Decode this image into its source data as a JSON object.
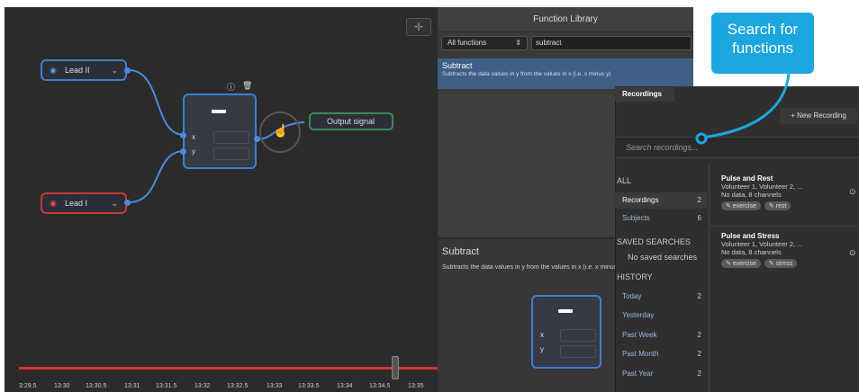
{
  "canvas": {
    "corner_icon": "crosshair-icon",
    "input_nodes": [
      {
        "label": "Lead II",
        "color": "#3f7fd1"
      },
      {
        "label": "Lead I",
        "color": "#c8393a"
      }
    ],
    "function_node": {
      "port_x": "x",
      "port_y": "y"
    },
    "output_node": {
      "label": "Output signal",
      "color": "#3a8a57"
    },
    "timeline": {
      "ticks": [
        "3:29.5",
        "13:30",
        "13:30.5",
        "13:31",
        "13:31.5",
        "13:32",
        "13:32.5",
        "13:33",
        "13:33.5",
        "13:34",
        "13:34.5",
        "13:35"
      ]
    }
  },
  "library": {
    "title": "Function Library",
    "filter_value": "All functions",
    "search_value": "subtract",
    "result": {
      "title": "Subtract",
      "description": "Subtracts the data values in y from the values in x (i.e. x minus y)"
    },
    "detail": {
      "title": "Subtract",
      "description": "Subtracts the data values in y from the values in x (i.e. x minus y)",
      "port_x": "x",
      "port_y": "y"
    }
  },
  "recordings": {
    "tab": "Recordings",
    "new_button": "+ New Recording",
    "search_placeholder": "Search recordings...",
    "all_heading": "ALL",
    "all_items": [
      {
        "label": "Recordings",
        "count": "2"
      },
      {
        "label": "Subjects",
        "count": "6"
      }
    ],
    "saved_heading": "SAVED SEARCHES",
    "saved_empty": "No saved searches",
    "history_heading": "HISTORY",
    "history_items": [
      {
        "label": "Today",
        "count": "2"
      },
      {
        "label": "Yesterday",
        "count": ""
      },
      {
        "label": "Past Week",
        "count": "2"
      },
      {
        "label": "Past Month",
        "count": "2"
      },
      {
        "label": "Past Year",
        "count": "2"
      }
    ],
    "items": [
      {
        "title": "Pulse and Rest",
        "subjects": "Volunteer 1, Volunteer 2, ...",
        "info": "No data, 8 channels",
        "tags": [
          "exercise",
          "rest"
        ]
      },
      {
        "title": "Pulse and Stress",
        "subjects": "Volunteer 1, Volunteer 2, ...",
        "info": "No data, 8 channels",
        "tags": [
          "exercise",
          "stress"
        ]
      }
    ]
  },
  "callout": {
    "text": "Search for functions",
    "color": "#1ba6e0"
  }
}
